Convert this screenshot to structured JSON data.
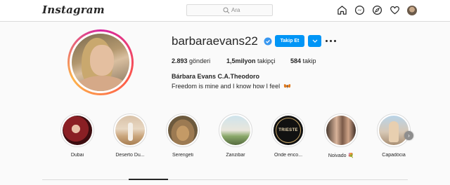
{
  "app": {
    "logo": "Instagram"
  },
  "search": {
    "placeholder": "Ara"
  },
  "nav": {
    "icons": [
      "home-icon",
      "messenger-icon",
      "explore-icon",
      "heart-icon",
      "avatar"
    ]
  },
  "profile": {
    "username": "barbaraevans22",
    "follow_label": "Takip Et",
    "stats": {
      "posts_value": "2.893",
      "posts_label": "gönderi",
      "followers_value": "1,5milyon",
      "followers_label": "takipçi",
      "following_value": "584",
      "following_label": "takip"
    },
    "full_name": "Bárbara Evans C.A.Theodoro",
    "bio": "Freedom is mine and I know how I feel"
  },
  "highlights": [
    {
      "label": "Dubai"
    },
    {
      "label": "Deserto Du..."
    },
    {
      "label": "Serengeti"
    },
    {
      "label": "Zanzibar"
    },
    {
      "label": "Onde enco...",
      "cover_text": "TRIESTE"
    },
    {
      "label": "Noivado 💐"
    },
    {
      "label": "Capadócia"
    }
  ],
  "colors": {
    "accent": "#0095f6",
    "text": "#262626",
    "border": "#dbdbdb",
    "background": "#fafafa"
  }
}
